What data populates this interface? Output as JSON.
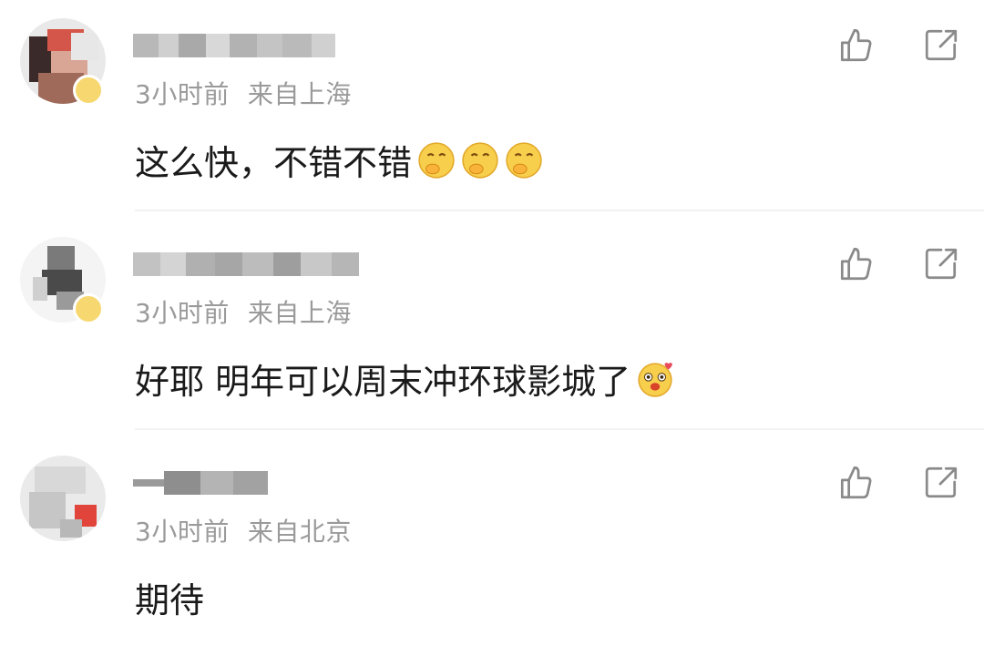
{
  "comments": [
    {
      "time": "3小时前",
      "location": "来自上海",
      "text": "这么快，不错不错",
      "emoji_name": "think-emoji",
      "emoji_count": 3,
      "colors": [
        "#d4a59a",
        "#8a5a4a",
        "#e04a3a",
        "#3a2a2a"
      ]
    },
    {
      "time": "3小时前",
      "location": "来自上海",
      "text": "好耶 明年可以周末冲环球影城了",
      "emoji_name": "excited-emoji",
      "emoji_count": 1,
      "colors": [
        "#e8e8e8",
        "#6a6a6a",
        "#9a9a9a",
        "#2a2a2a"
      ]
    },
    {
      "time": "3小时前",
      "location": "来自北京",
      "text": "期待",
      "emoji_name": "",
      "emoji_count": 0,
      "colors": [
        "#dcdcdc",
        "#c8c8c8",
        "#e0443a",
        "#f0f0f0"
      ]
    }
  ],
  "icons": {
    "like": "thumbs-up-icon",
    "share": "share-icon"
  },
  "accent_color": "#9a9a9a"
}
